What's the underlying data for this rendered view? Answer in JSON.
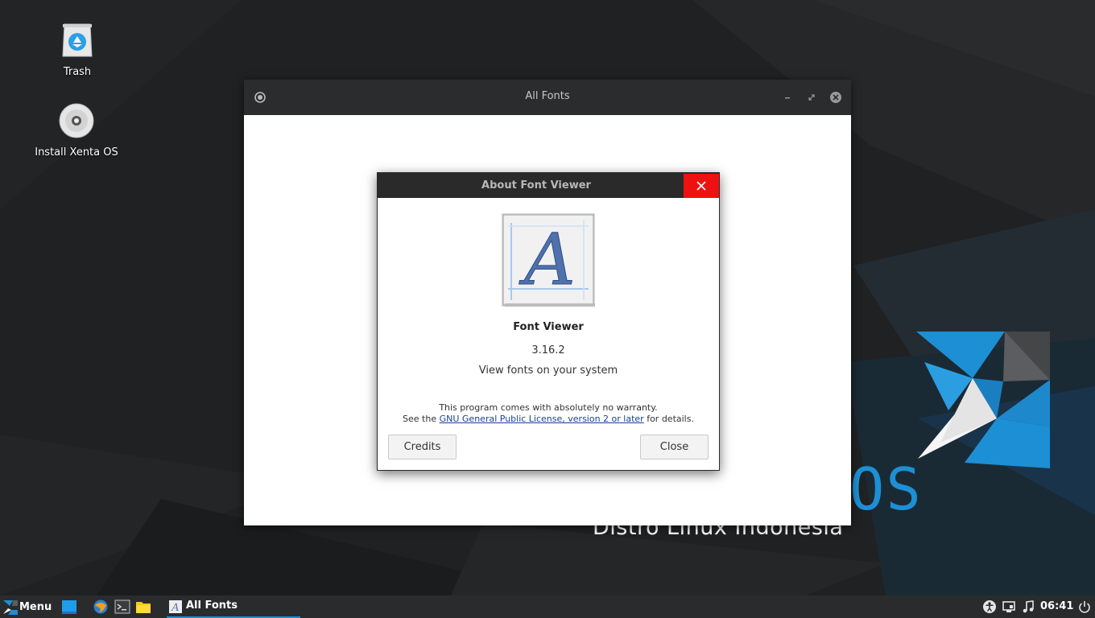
{
  "desktop": {
    "wallpaper_text": "Distro Linux Indonesia",
    "wallpaper_os": "OS",
    "icons": [
      {
        "label": "Trash",
        "icon": "trash-icon"
      },
      {
        "label": "Install Xenta OS",
        "icon": "disc-icon"
      }
    ]
  },
  "main_window": {
    "title": "All Fonts"
  },
  "about_dialog": {
    "title": "About Font Viewer",
    "app_name": "Font Viewer",
    "version": "3.16.2",
    "description": "View fonts on your system",
    "warranty_text": "This program comes with absolutely no warranty.",
    "license_prefix": "See the ",
    "license_link": "GNU General Public License, version 2 or later",
    "license_suffix": " for details.",
    "credits_label": "Credits",
    "close_label": "Close"
  },
  "taskbar": {
    "menu_label": "Menu",
    "task_label": "All Fonts",
    "clock": "06:41"
  },
  "colors": {
    "accent": "#1d8fd4",
    "close_red": "#ee1111",
    "titlebar": "#2b2c2e",
    "desktop_bg": "#1f2022"
  }
}
